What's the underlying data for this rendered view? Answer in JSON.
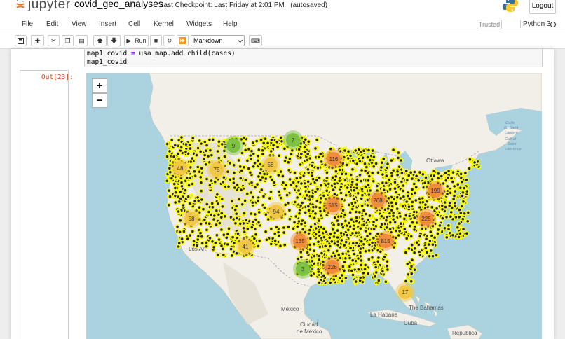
{
  "header": {
    "logo_text": "jupyter",
    "notebook_name": "covid_geo_analyses",
    "checkpoint": "Last Checkpoint: Last Friday at 2:01 PM",
    "autosave": "(autosaved)",
    "logout_label": "Logout"
  },
  "menu": [
    "File",
    "Edit",
    "View",
    "Insert",
    "Cell",
    "Kernel",
    "Widgets",
    "Help"
  ],
  "status": {
    "trusted": "Trusted",
    "kernel": "Python 3"
  },
  "toolbar": {
    "run_label": "Run",
    "cell_type": "Markdown"
  },
  "code": {
    "line1": "map1_covid = usa_map.add_child(cases)",
    "line2": "map1_covid"
  },
  "output": {
    "prompt": "Out[23]:"
  },
  "map": {
    "zoom_in": "+",
    "zoom_out": "−",
    "labels": {
      "ottawa": "Ottawa",
      "los_angeles": "Los An",
      "mexico": "México",
      "ciudad_mexico_1": "Ciudad",
      "ciudad_mexico_2": "de México",
      "la_habana": "La Habana",
      "cuba": "Cuba",
      "bahamas": "The Bahamas",
      "republica": "República",
      "golfe": [
        "Golfe",
        "du Saint-",
        "Laurent",
        "Gulf of",
        "Saint",
        "Lawrence"
      ]
    },
    "clusters": [
      {
        "label": "9",
        "color": "#7dc243"
      },
      {
        "label": "7",
        "color": "#7dc243"
      },
      {
        "label": "48",
        "color": "#f2c744"
      },
      {
        "label": "75",
        "color": "#f2c744"
      },
      {
        "label": "58",
        "color": "#f2c744"
      },
      {
        "label": "116",
        "color": "#f08c3c"
      },
      {
        "label": "58",
        "color": "#f2c744"
      },
      {
        "label": "94",
        "color": "#f2c744"
      },
      {
        "label": "515",
        "color": "#f08c3c"
      },
      {
        "label": "268",
        "color": "#f08c3c"
      },
      {
        "label": "199",
        "color": "#f08c3c"
      },
      {
        "label": "225",
        "color": "#f08c3c"
      },
      {
        "label": "135",
        "color": "#f08c3c"
      },
      {
        "label": "41",
        "color": "#f2c744"
      },
      {
        "label": "815",
        "color": "#f08c3c"
      },
      {
        "label": "3",
        "color": "#7dc243"
      },
      {
        "label": "226",
        "color": "#f08c3c"
      },
      {
        "label": "17",
        "color": "#f2c744"
      }
    ]
  }
}
